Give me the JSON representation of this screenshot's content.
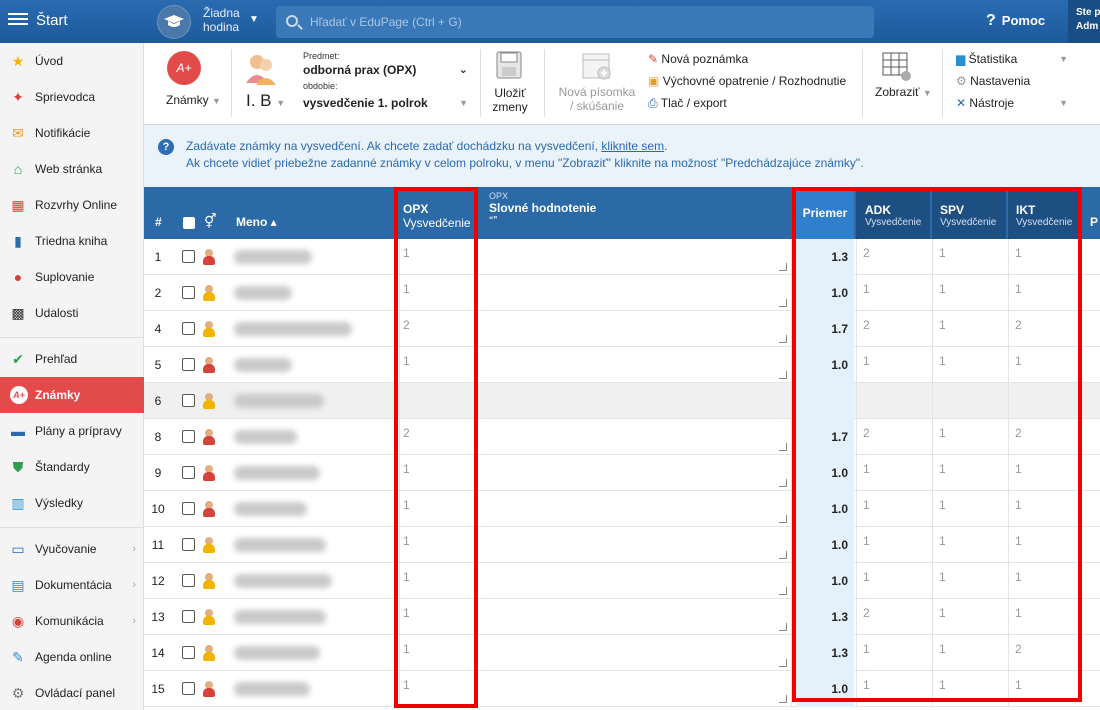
{
  "topbar": {
    "start": "Štart",
    "hour_line1": "Žiadna",
    "hour_line2": "hodina",
    "search_placeholder": "Hľadať v EduPage (Ctrl + G)",
    "help": "Pomoc",
    "user_line1": "Ste p",
    "user_line2": "Adm"
  },
  "sidebar": {
    "items": [
      {
        "label": "Úvod",
        "icon": "star-icon"
      },
      {
        "label": "Sprievodca",
        "icon": "wand-icon"
      },
      {
        "label": "Notifikácie",
        "icon": "envelope-icon"
      },
      {
        "label": "Web stránka",
        "icon": "house-icon"
      },
      {
        "label": "Rozvrhy Online",
        "icon": "grid-calendar-icon"
      },
      {
        "label": "Triedna kniha",
        "icon": "book-icon"
      },
      {
        "label": "Suplovanie",
        "icon": "person-icon"
      },
      {
        "label": "Udalosti",
        "icon": "calendar-icon"
      },
      {
        "label": "Prehľad",
        "icon": "check-circle-icon"
      },
      {
        "label": "Známky",
        "icon": "grade-icon"
      },
      {
        "label": "Plány a prípravy",
        "icon": "briefcase-icon"
      },
      {
        "label": "Štandardy",
        "icon": "shield-check-icon"
      },
      {
        "label": "Výsledky",
        "icon": "bar-chart-icon"
      },
      {
        "label": "Vyučovanie",
        "icon": "open-book-icon"
      },
      {
        "label": "Dokumentácia",
        "icon": "document-icon"
      },
      {
        "label": "Komunikácia",
        "icon": "chat-icon"
      },
      {
        "label": "Agenda online",
        "icon": "pen-icon"
      },
      {
        "label": "Ovládací panel",
        "icon": "gear-icon"
      }
    ]
  },
  "toolbar": {
    "znamky": "Známky",
    "grade_icon_text": "A+",
    "class": "I. B",
    "predmet_label": "Predmet:",
    "predmet_value": "odborná prax (OPX)",
    "obdobie_label": "obdobie:",
    "obdobie_value": "vysvedčenie 1. polrok",
    "ulozit_line1": "Uložiť",
    "ulozit_line2": "zmeny",
    "nova_line1": "Nová písomka",
    "nova_line2": "/ skúšanie",
    "nova_poznamka": "Nová poznámka",
    "vychovne": "Výchovné opatrenie / Rozhodnutie",
    "tlac": "Tlač / export",
    "zobrazit": "Zobraziť",
    "statistika": "Štatistika",
    "nastavenia": "Nastavenia",
    "nastroje": "Nástroje"
  },
  "info": {
    "line1_prefix": "Zadávate známky na vysvedčení. Ak chcete zadať dochádzku na vysvedčení, ",
    "line1_link": "kliknite sem",
    "line1_suffix": ".",
    "line2": "Ak chcete vidieť priebežne zadanné známky v celom polroku, v menu \"Zobraziť\" kliknite na možnosť \"Predchádzajúce známky\"."
  },
  "table": {
    "col_num": "#",
    "col_gender": "⚥",
    "col_meno": "Meno ▴",
    "opx_small": "OPX",
    "opx_title": "OPX",
    "opx_sub": "Vysvedčenie",
    "slovne_small": "OPX",
    "slovne_title": "Slovné hodnotenie",
    "slovne_quote": "❝❞",
    "priemer": "Priemer",
    "adk": "ADK",
    "spv": "SPV",
    "ikt": "IKT",
    "sub_vysv": "Vysvedčenie",
    "p_partial": "P",
    "rows": [
      {
        "n": "1",
        "opx": "1",
        "avg": "1.3",
        "adk": "2",
        "spv": "1",
        "ikt": "1",
        "g": "m"
      },
      {
        "n": "2",
        "opx": "1",
        "avg": "1.0",
        "adk": "1",
        "spv": "1",
        "ikt": "1",
        "g": "f"
      },
      {
        "n": "4",
        "opx": "2",
        "avg": "1.7",
        "adk": "2",
        "spv": "1",
        "ikt": "2",
        "g": "f"
      },
      {
        "n": "5",
        "opx": "1",
        "avg": "1.0",
        "adk": "1",
        "spv": "1",
        "ikt": "1",
        "g": "m"
      },
      {
        "n": "6",
        "opx": "",
        "avg": "",
        "adk": "",
        "spv": "",
        "ikt": "",
        "g": "f"
      },
      {
        "n": "8",
        "opx": "2",
        "avg": "1.7",
        "adk": "2",
        "spv": "1",
        "ikt": "2",
        "g": "m"
      },
      {
        "n": "9",
        "opx": "1",
        "avg": "1.0",
        "adk": "1",
        "spv": "1",
        "ikt": "1",
        "g": "m"
      },
      {
        "n": "10",
        "opx": "1",
        "avg": "1.0",
        "adk": "1",
        "spv": "1",
        "ikt": "1",
        "g": "m"
      },
      {
        "n": "11",
        "opx": "1",
        "avg": "1.0",
        "adk": "1",
        "spv": "1",
        "ikt": "1",
        "g": "f"
      },
      {
        "n": "12",
        "opx": "1",
        "avg": "1.0",
        "adk": "1",
        "spv": "1",
        "ikt": "1",
        "g": "f"
      },
      {
        "n": "13",
        "opx": "1",
        "avg": "1.3",
        "adk": "2",
        "spv": "1",
        "ikt": "1",
        "g": "f"
      },
      {
        "n": "14",
        "opx": "1",
        "avg": "1.3",
        "adk": "1",
        "spv": "1",
        "ikt": "2",
        "g": "f"
      },
      {
        "n": "15",
        "opx": "1",
        "avg": "1.0",
        "adk": "1",
        "spv": "1",
        "ikt": "1",
        "g": "m"
      }
    ]
  },
  "colors": {
    "accent": "#e34b4b",
    "header": "#2b6aa6",
    "highlight": "#e00000"
  }
}
